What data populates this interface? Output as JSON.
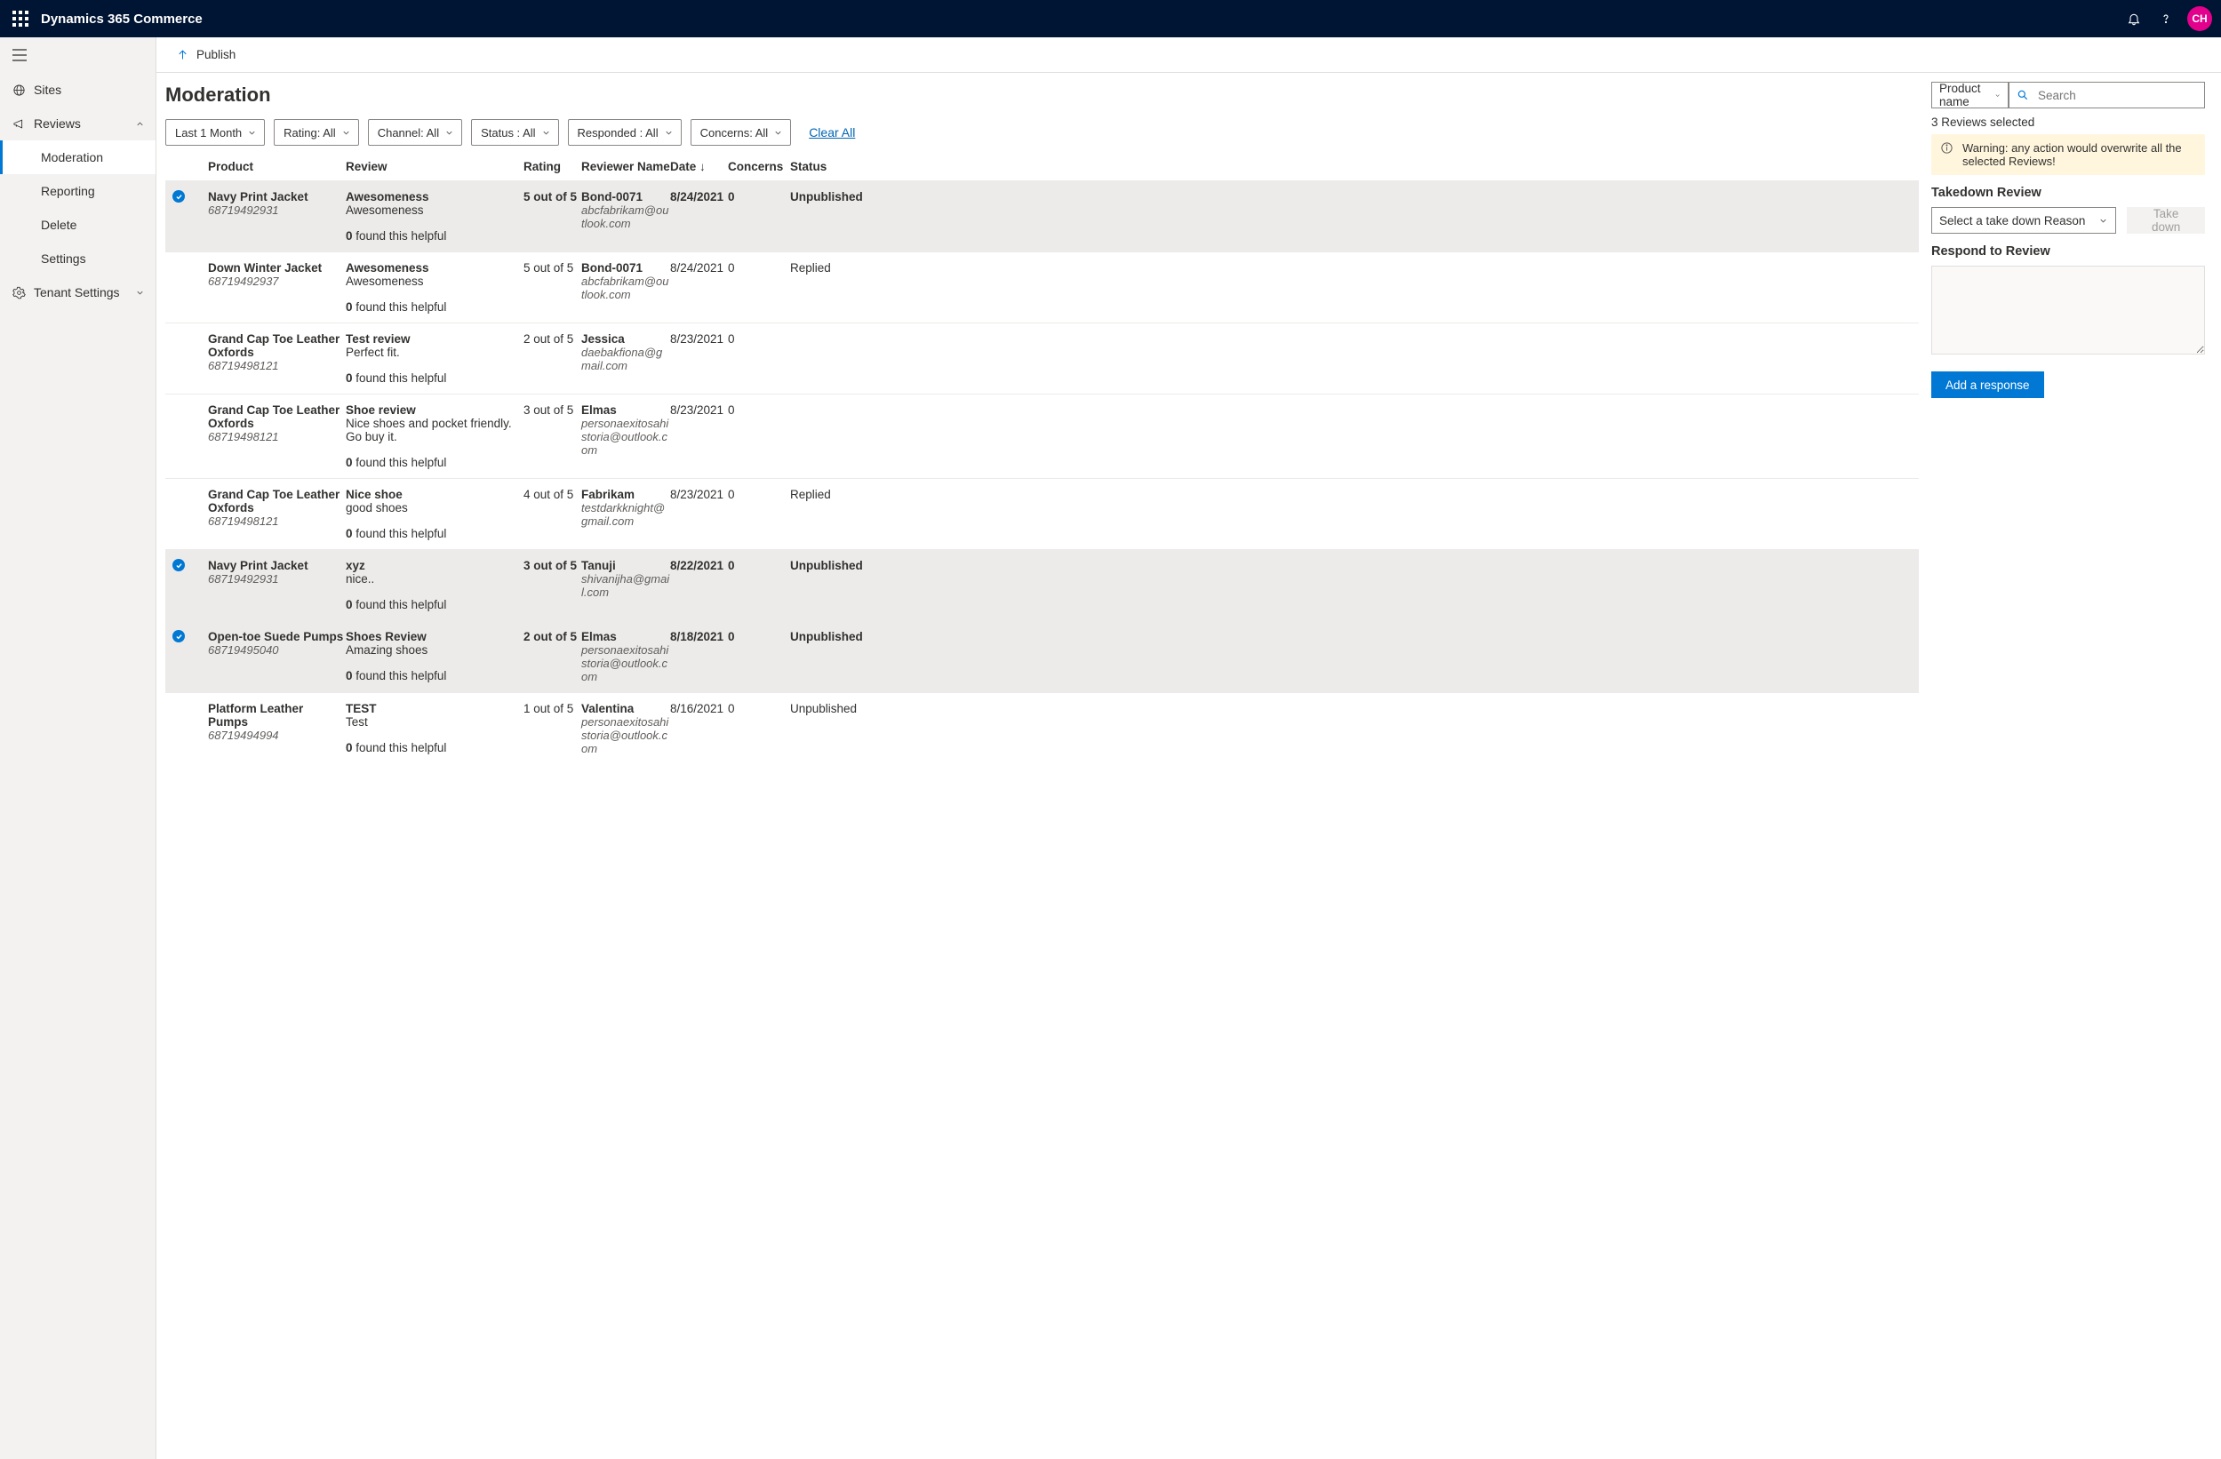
{
  "topbar": {
    "brand": "Dynamics 365 Commerce",
    "avatar": "CH"
  },
  "nav": {
    "sites": "Sites",
    "reviews": "Reviews",
    "moderation": "Moderation",
    "reporting": "Reporting",
    "delete": "Delete",
    "settings": "Settings",
    "tenant": "Tenant Settings"
  },
  "cmd": {
    "publish": "Publish"
  },
  "page": {
    "title": "Moderation"
  },
  "filters": {
    "period": "Last 1 Month",
    "rating": "Rating: All",
    "channel": "Channel: All",
    "status": "Status : All",
    "responded": "Responded : All",
    "concerns": "Concerns: All",
    "clear": "Clear All"
  },
  "columns": {
    "product": "Product",
    "review": "Review",
    "rating": "Rating",
    "reviewer": "Reviewer Name",
    "date": "Date",
    "concerns": "Concerns",
    "status": "Status"
  },
  "rows": [
    {
      "selected": true,
      "product": "Navy Print Jacket",
      "sku": "68719492931",
      "title": "Awesomeness",
      "body": "Awesomeness",
      "helpful": "0",
      "rating": "5 out of 5",
      "reviewer": "Bond-0071",
      "email": "abcfabrikam@outlook.com",
      "date": "8/24/2021",
      "concerns": "0",
      "status": "Unpublished"
    },
    {
      "selected": false,
      "product": "Down Winter Jacket",
      "sku": "68719492937",
      "title": "Awesomeness",
      "body": "Awesomeness",
      "helpful": "0",
      "rating": "5 out of 5",
      "reviewer": "Bond-0071",
      "email": "abcfabrikam@outlook.com",
      "date": "8/24/2021",
      "concerns": "0",
      "status": "Replied"
    },
    {
      "selected": false,
      "product": "Grand Cap Toe Leather Oxfords",
      "sku": "68719498121",
      "title": "Test review",
      "body": "Perfect fit.",
      "helpful": "0",
      "rating": "2 out of 5",
      "reviewer": "Jessica",
      "email": "daebakfiona@gmail.com",
      "date": "8/23/2021",
      "concerns": "0",
      "status": ""
    },
    {
      "selected": false,
      "product": "Grand Cap Toe Leather Oxfords",
      "sku": "68719498121",
      "title": "Shoe review",
      "body": "Nice shoes and pocket friendly. Go buy it.",
      "helpful": "0",
      "rating": "3 out of 5",
      "reviewer": "Elmas",
      "email": "personaexitosahistoria@outlook.com",
      "date": "8/23/2021",
      "concerns": "0",
      "status": ""
    },
    {
      "selected": false,
      "product": "Grand Cap Toe Leather Oxfords",
      "sku": "68719498121",
      "title": "Nice shoe",
      "body": "good shoes",
      "helpful": "0",
      "rating": "4 out of 5",
      "reviewer": "Fabrikam",
      "email": "testdarkknight@gmail.com",
      "date": "8/23/2021",
      "concerns": "0",
      "status": "Replied"
    },
    {
      "selected": true,
      "product": "Navy Print Jacket",
      "sku": "68719492931",
      "title": "xyz",
      "body": "nice..",
      "helpful": "0",
      "rating": "3 out of 5",
      "reviewer": "Tanuji",
      "email": "shivanijha@gmail.com",
      "date": "8/22/2021",
      "concerns": "0",
      "status": "Unpublished"
    },
    {
      "selected": true,
      "product": "Open-toe Suede Pumps",
      "sku": "68719495040",
      "title": "Shoes Review",
      "body": "Amazing shoes",
      "helpful": "0",
      "rating": "2 out of 5",
      "reviewer": "Elmas",
      "email": "personaexitosahistoria@outlook.com",
      "date": "8/18/2021",
      "concerns": "0",
      "status": "Unpublished"
    },
    {
      "selected": false,
      "product": "Platform Leather Pumps",
      "sku": "68719494994",
      "title": "TEST",
      "body": "Test",
      "helpful": "0",
      "rating": "1 out of 5",
      "reviewer": "Valentina",
      "email": "personaexitosahistoria@outlook.com",
      "date": "8/16/2021",
      "concerns": "0",
      "status": "Unpublished"
    }
  ],
  "helpful_suffix": " found this helpful",
  "panel": {
    "search_dd": "Product name",
    "search_placeholder": "Search",
    "selected": "3 Reviews selected",
    "warning": "Warning: any action would overwrite all the selected Reviews!",
    "takedown_h": "Takedown Review",
    "takedown_dd": "Select a take down Reason",
    "takedown_btn": "Take down",
    "respond_h": "Respond to Review",
    "respond_btn": "Add a response"
  }
}
